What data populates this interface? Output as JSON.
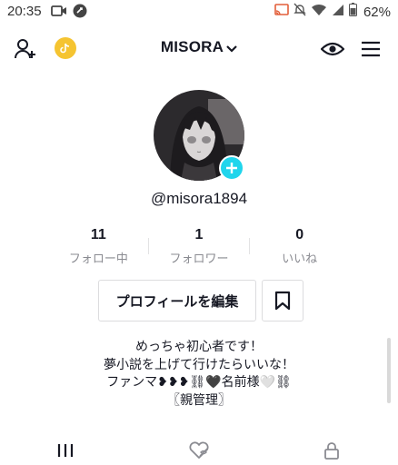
{
  "status_bar": {
    "time": "20:35",
    "battery_percent": "62%",
    "icons": [
      "video-call-icon",
      "app-notification-icon",
      "cast-icon",
      "mute-icon",
      "wifi-icon",
      "signal-icon",
      "battery-icon"
    ]
  },
  "header": {
    "username": "MISORA",
    "left_icons": [
      "add-friend-icon",
      "coin-icon"
    ],
    "right_icons": [
      "eye-icon",
      "menu-icon"
    ]
  },
  "profile": {
    "handle": "@misora1894",
    "stats": [
      {
        "value": "11",
        "label": "フォロー中"
      },
      {
        "value": "1",
        "label": "フォロワー"
      },
      {
        "value": "0",
        "label": "いいね"
      }
    ],
    "edit_button_label": "プロフィールを編集",
    "bio_lines": [
      "めっちゃ初心者です！",
      "夢小説を上げて行けたらいいな！",
      "ファンマ❥❥❥⛓🖤名前様🤍⛓",
      "〖親管理〗"
    ]
  },
  "tabs": [
    "videos-grid-icon",
    "liked-hidden-icon",
    "private-lock-icon"
  ],
  "colors": {
    "accent": "#20d5ec",
    "text": "#161823",
    "muted": "#8a8b91",
    "coin": "#f5c431"
  }
}
